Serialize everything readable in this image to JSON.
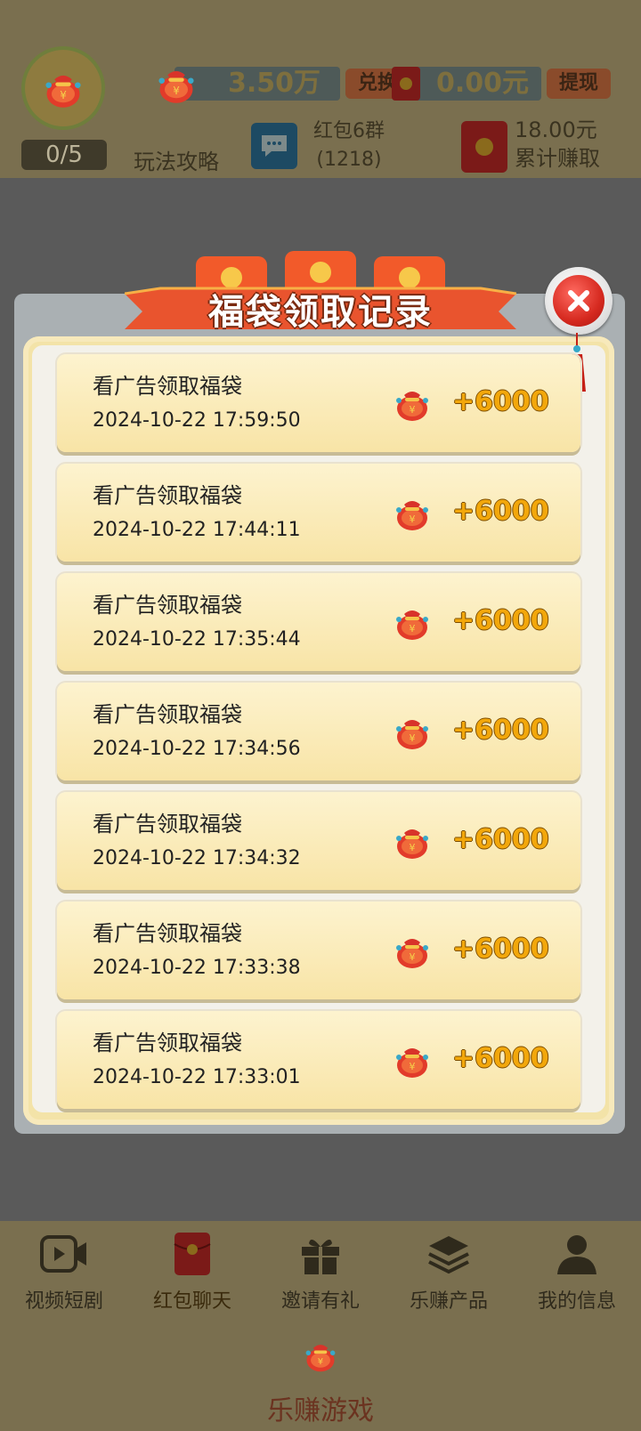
{
  "header": {
    "progress": "0/5",
    "guide": "玩法攻略",
    "coins": "3.50万",
    "exchange": "兑换",
    "cash": "0.00元",
    "withdraw": "提现",
    "chat_group": "红包6群",
    "chat_count": "(1218)",
    "total_earned": "18.00元",
    "total_earned_label": "累计赚取"
  },
  "modal": {
    "title": "福袋领取记录",
    "records": [
      {
        "title": "看广告领取福袋",
        "time": "2024-10-22 17:59:50",
        "amount": "+6000"
      },
      {
        "title": "看广告领取福袋",
        "time": "2024-10-22 17:44:11",
        "amount": "+6000"
      },
      {
        "title": "看广告领取福袋",
        "time": "2024-10-22 17:35:44",
        "amount": "+6000"
      },
      {
        "title": "看广告领取福袋",
        "time": "2024-10-22 17:34:56",
        "amount": "+6000"
      },
      {
        "title": "看广告领取福袋",
        "time": "2024-10-22 17:34:32",
        "amount": "+6000"
      },
      {
        "title": "看广告领取福袋",
        "time": "2024-10-22 17:33:38",
        "amount": "+6000"
      },
      {
        "title": "看广告领取福袋",
        "time": "2024-10-22 17:33:01",
        "amount": "+6000"
      }
    ]
  },
  "nav": {
    "items": [
      {
        "label": "视频短剧",
        "icon": "video-icon"
      },
      {
        "label": "红包聊天",
        "icon": "red-envelope-icon"
      },
      {
        "label": "邀请有礼",
        "icon": "gift-icon"
      },
      {
        "label": "乐赚产品",
        "icon": "layers-icon"
      },
      {
        "label": "我的信息",
        "icon": "user-icon"
      }
    ],
    "bottom_label": "乐赚游戏"
  },
  "colors": {
    "amount": "#f2a70b",
    "record_bg": "#fdf3cf",
    "close_red": "#d62a20"
  }
}
